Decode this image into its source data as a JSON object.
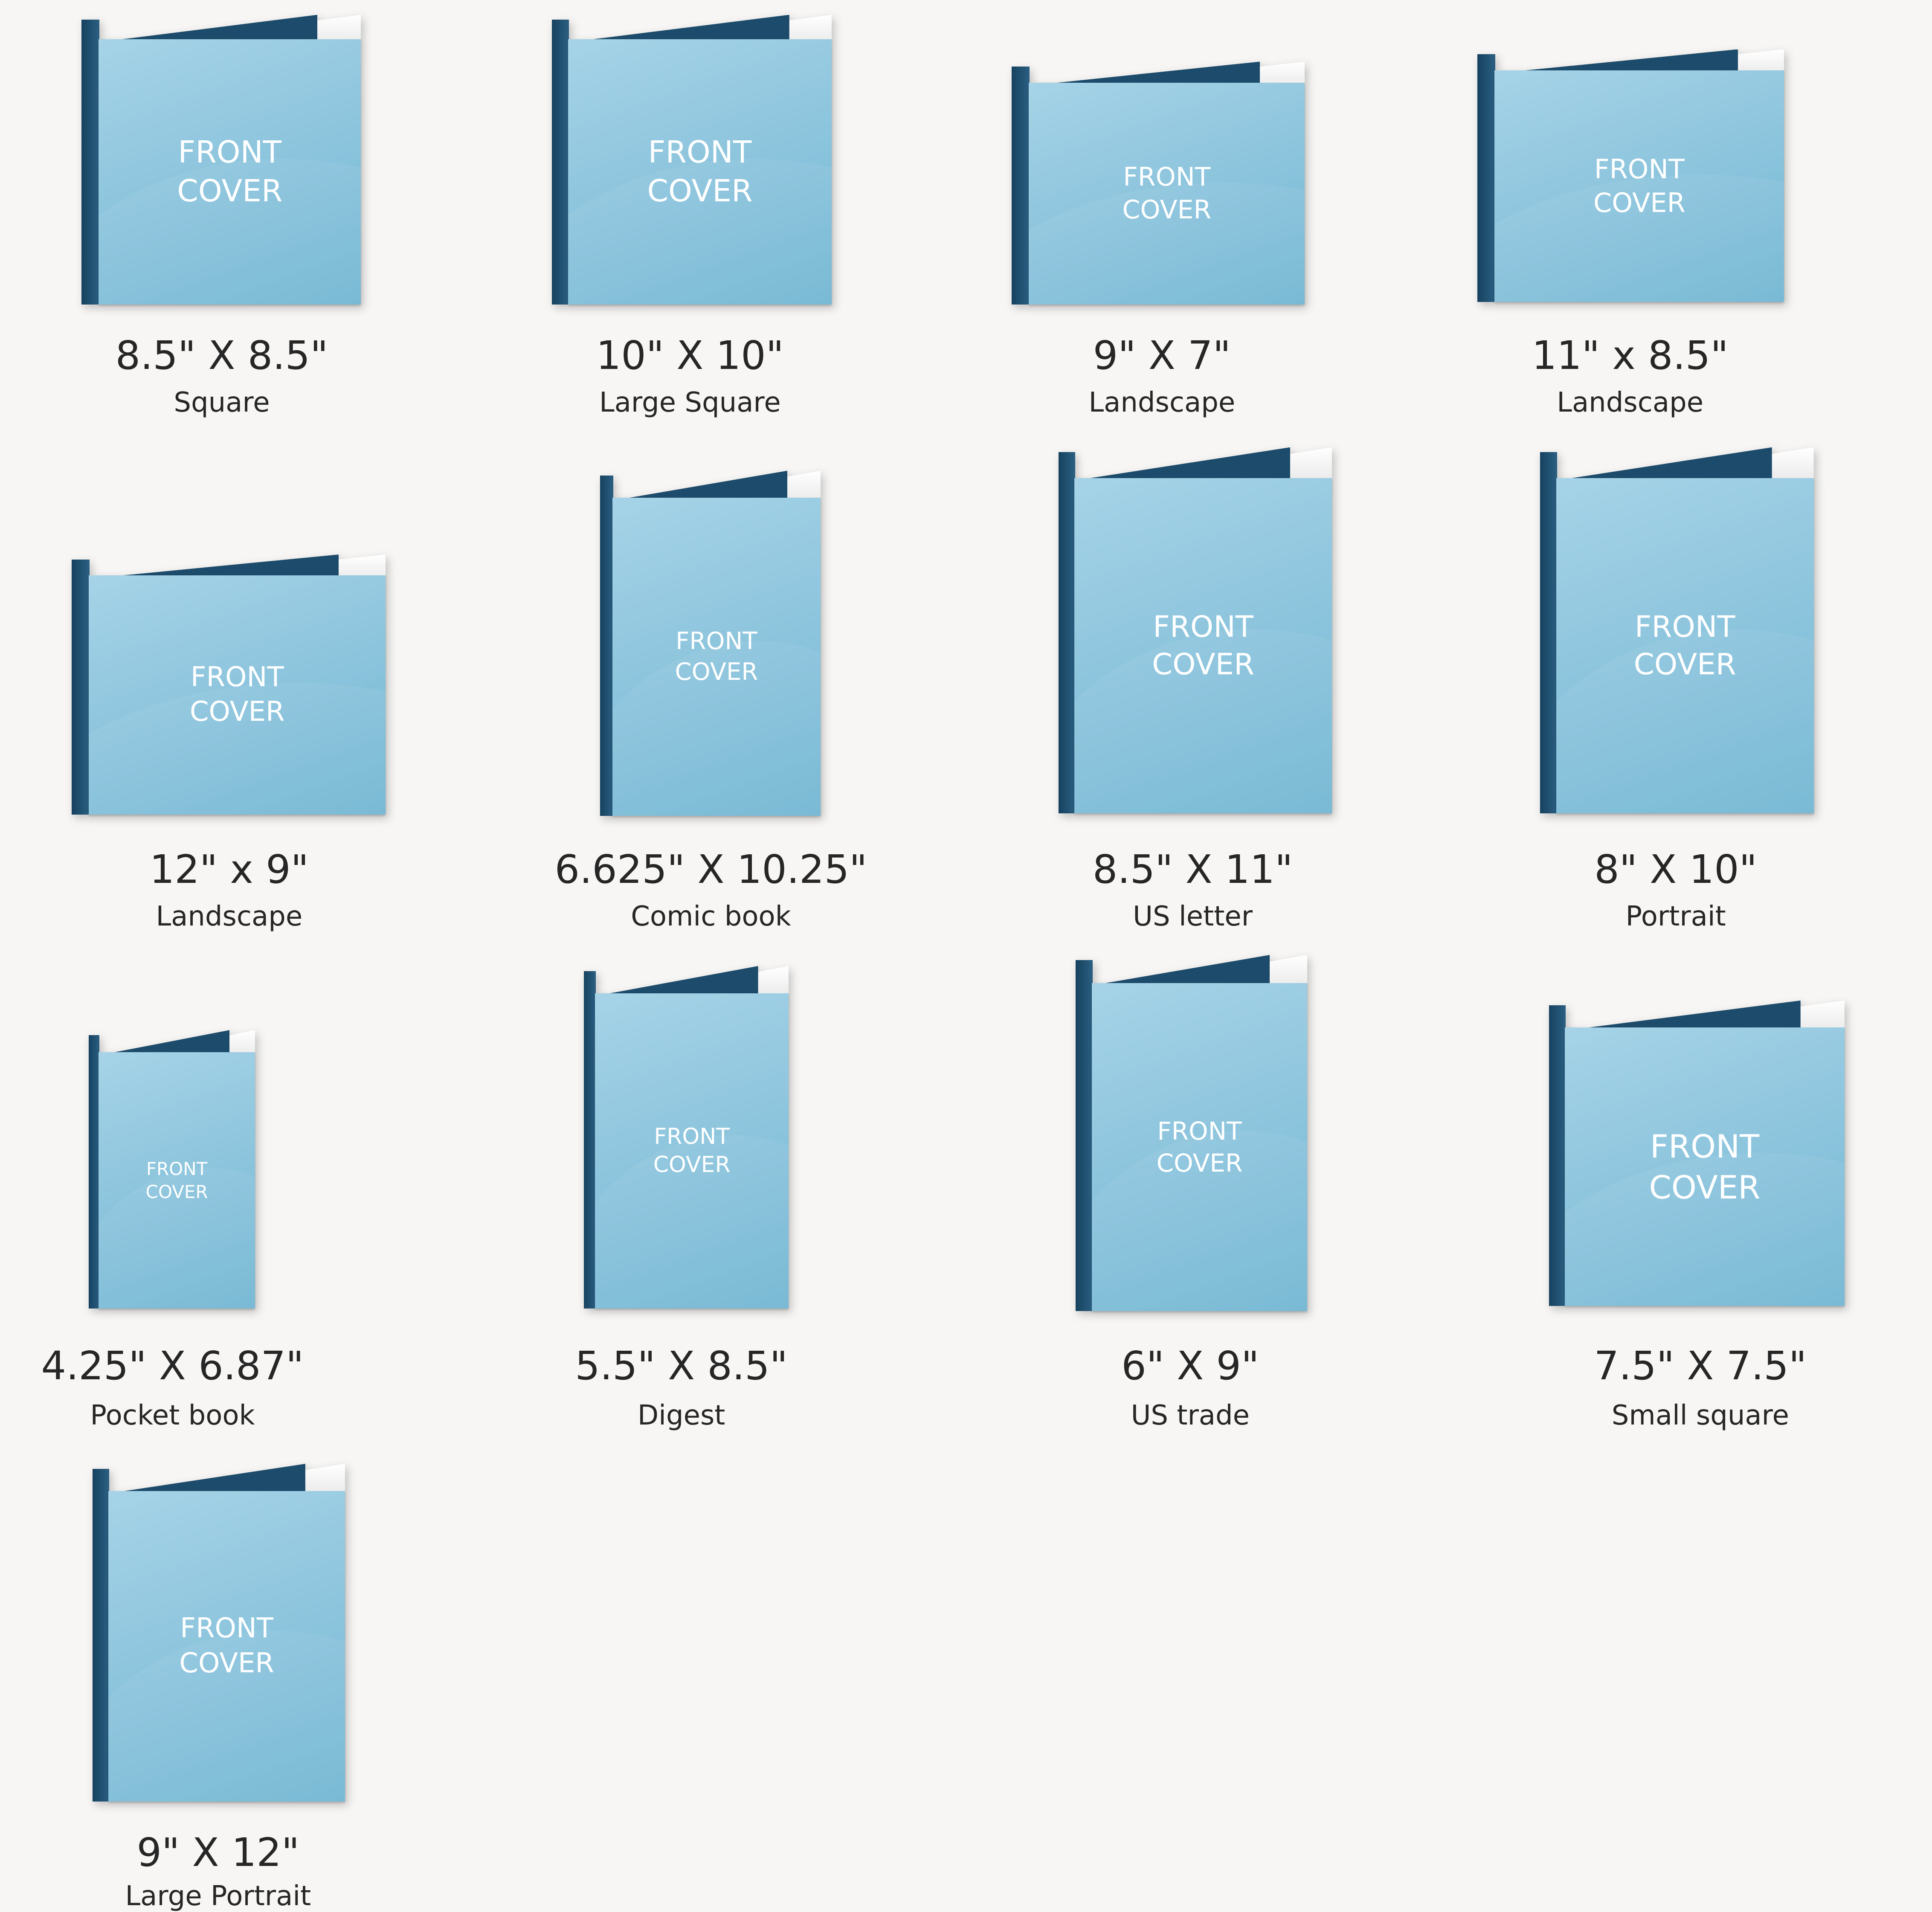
{
  "cover_label": {
    "line1": "FRONT",
    "line2": "COVER"
  },
  "colors": {
    "background": "#f7f6f4",
    "cover": "#8fc6de",
    "spine": "#1d4b6b",
    "text": "#262626"
  },
  "books": [
    {
      "size": "8.5\" X 8.5\"",
      "type": "Square"
    },
    {
      "size": "10\" X 10\"",
      "type": "Large Square"
    },
    {
      "size": "9\" X 7\"",
      "type": "Landscape"
    },
    {
      "size": "11\" x 8.5\"",
      "type": "Landscape"
    },
    {
      "size": "12\" x 9\"",
      "type": "Landscape"
    },
    {
      "size": "6.625\" X 10.25\"",
      "type": "Comic book"
    },
    {
      "size": "8.5\" X 11\"",
      "type": "US letter"
    },
    {
      "size": "8\" X 10\"",
      "type": "Portrait"
    },
    {
      "size": "4.25\" X 6.87\"",
      "type": "Pocket book"
    },
    {
      "size": "5.5\" X 8.5\"",
      "type": "Digest"
    },
    {
      "size": "6\" X 9\"",
      "type": "US trade"
    },
    {
      "size": "7.5\" X 7.5\"",
      "type": "Small square"
    },
    {
      "size": "9\" X 12\"",
      "type": "Large Portrait"
    }
  ]
}
